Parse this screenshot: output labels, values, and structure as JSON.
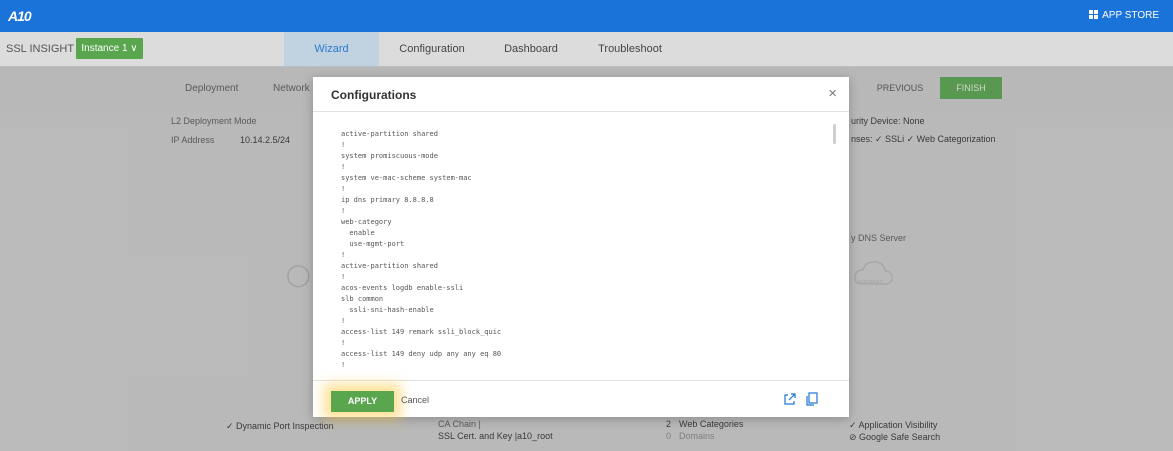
{
  "topbar": {
    "logo": "A10",
    "logo_sub": "™",
    "app_store": "APP STORE"
  },
  "navbar": {
    "product": "SSL INSIGHT",
    "instance": "Instance 1 ∨",
    "tabs": [
      "Wizard",
      "Configuration",
      "Dashboard",
      "Troubleshoot"
    ],
    "active_tab": "Wizard"
  },
  "wizard": {
    "steps": [
      "Deployment",
      "Network"
    ],
    "previous": "PREVIOUS",
    "finish": "FINISH",
    "mode": "L2 Deployment Mode",
    "ip_label": "IP Address",
    "ip_value": "10.14.2.5/24",
    "security_device": "urity Device: None",
    "licenses": "nses:  ✓ SSLi  ✓ Web Categorization",
    "dns": "y DNS Server",
    "internet": "INTERNET"
  },
  "modal": {
    "title": "Configurations",
    "close": "×",
    "config_lines": [
      "active-partition shared",
      "!",
      "system promiscuous-mode",
      "!",
      "system ve-mac-scheme system-mac",
      "!",
      "ip dns primary 8.8.8.8",
      "!",
      "web-category",
      "  enable",
      "  use-mgmt-port",
      "!",
      "active-partition shared",
      "!",
      "acos-events logdb enable-ssli",
      "slb common",
      "  ssli-sni-hash-enable",
      "!",
      "access-list 149 remark ssli_block_quic",
      "!",
      "access-list 149 deny udp any any eq 80",
      "!"
    ],
    "apply": "APPLY",
    "cancel": "Cancel"
  },
  "bottom": {
    "dynamic_port": "✓  Dynamic Port Inspection",
    "ca_chain": "CA Chain |",
    "ssl_cert": "SSL Cert. and Key |a10_root",
    "web_cat_count": "2",
    "web_categories": "Web Categories",
    "domains_count": "0",
    "domains": "Domains",
    "app_visibility": "✓  Application Visibility",
    "google_safe": "⊘  Google Safe Search"
  },
  "colors": {
    "brand_blue": "#1a73d9",
    "accent_green": "#5aa64f",
    "icon_blue": "#1e74d3"
  }
}
